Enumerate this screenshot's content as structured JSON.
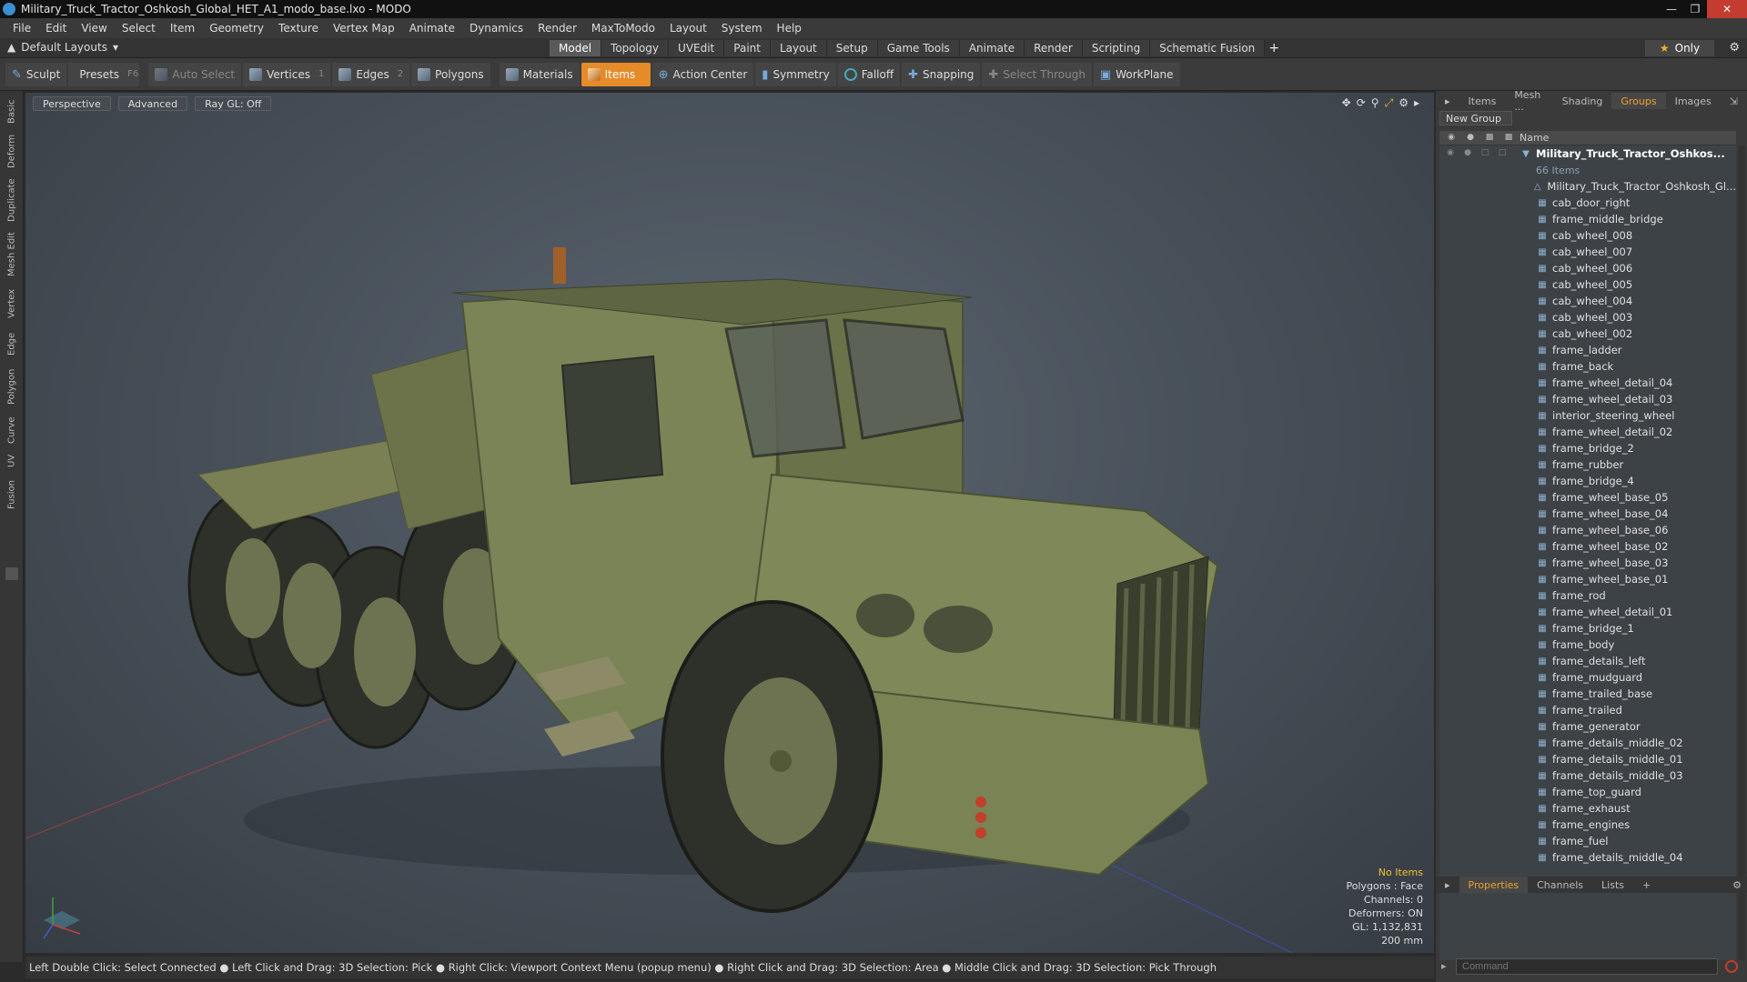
{
  "window": {
    "title": "Military_Truck_Tractor_Oshkosh_Global_HET_A1_modo_base.lxo - MODO"
  },
  "menu": [
    "File",
    "Edit",
    "View",
    "Select",
    "Item",
    "Geometry",
    "Texture",
    "Vertex Map",
    "Animate",
    "Dynamics",
    "Render",
    "MaxToModo",
    "Layout",
    "System",
    "Help"
  ],
  "layout_selector": "Default Layouts",
  "mode_tabs": [
    {
      "label": "Model",
      "active": true
    },
    {
      "label": "Topology"
    },
    {
      "label": "UVEdit"
    },
    {
      "label": "Paint"
    },
    {
      "label": "Layout"
    },
    {
      "label": "Setup"
    },
    {
      "label": "Game Tools"
    },
    {
      "label": "Animate"
    },
    {
      "label": "Render"
    },
    {
      "label": "Scripting"
    },
    {
      "label": "Schematic Fusion"
    }
  ],
  "only_button": "Only",
  "toolbar": {
    "sculpt": "Sculpt",
    "presets": "Presets",
    "presets_key": "F6",
    "auto_select": "Auto Select",
    "vertices": "Vertices",
    "vertices_key": "1",
    "edges": "Edges",
    "edges_key": "2",
    "polygons": "Polygons",
    "materials": "Materials",
    "items": "Items",
    "action_center": "Action Center",
    "symmetry": "Symmetry",
    "falloff": "Falloff",
    "snapping": "Snapping",
    "select_through": "Select Through",
    "workplane": "WorkPlane"
  },
  "left_tabs": [
    "Basic",
    "Deform",
    "Duplicate",
    "Mesh Edit",
    "Vertex",
    "Edge",
    "Polygon",
    "Curve",
    "UV",
    "Fusion"
  ],
  "viewport": {
    "perspective": "Perspective",
    "advanced": "Advanced",
    "raygl": "Ray GL: Off",
    "info": {
      "no_items": "No Items",
      "polygons": "Polygons : Face",
      "channels": "Channels: 0",
      "deformers": "Deformers: ON",
      "gl": "GL: 1,132,831",
      "scale": "200 mm"
    }
  },
  "status_bar": "Left Double Click: Select Connected ● Left Click and Drag: 3D Selection: Pick ● Right Click: Viewport Context Menu (popup menu) ● Right Click and Drag: 3D Selection: Area ● Middle Click and Drag: 3D Selection: Pick Through",
  "right_panel": {
    "tabs": [
      {
        "label": "Items"
      },
      {
        "label": "Mesh ..."
      },
      {
        "label": "Shading"
      },
      {
        "label": "Groups",
        "active": true
      },
      {
        "label": "Images"
      }
    ],
    "new_group": "New Group",
    "name_header": "Name",
    "group_name": "Military_Truck_Tractor_Oshkos...",
    "group_count": "66 Items",
    "items": [
      "Military_Truck_Tractor_Oshkosh_Gl...",
      "cab_door_right",
      "frame_middle_bridge",
      "cab_wheel_008",
      "cab_wheel_007",
      "cab_wheel_006",
      "cab_wheel_005",
      "cab_wheel_004",
      "cab_wheel_003",
      "cab_wheel_002",
      "frame_ladder",
      "frame_back",
      "frame_wheel_detail_04",
      "frame_wheel_detail_03",
      "interior_steering_wheel",
      "frame_wheel_detail_02",
      "frame_bridge_2",
      "frame_rubber",
      "frame_bridge_4",
      "frame_wheel_base_05",
      "frame_wheel_base_04",
      "frame_wheel_base_06",
      "frame_wheel_base_02",
      "frame_wheel_base_03",
      "frame_wheel_base_01",
      "frame_rod",
      "frame_wheel_detail_01",
      "frame_bridge_1",
      "frame_body",
      "frame_details_left",
      "frame_mudguard",
      "frame_trailed_base",
      "frame_trailed",
      "frame_generator",
      "frame_details_middle_02",
      "frame_details_middle_01",
      "frame_details_middle_03",
      "frame_top_guard",
      "frame_exhaust",
      "frame_engines",
      "frame_fuel",
      "frame_details_middle_04"
    ],
    "prop_tabs": [
      {
        "label": "Properties",
        "active": true
      },
      {
        "label": "Channels"
      },
      {
        "label": "Lists"
      }
    ],
    "command_placeholder": "Command"
  },
  "colors": {
    "accent": "#e58b2a",
    "truck": "#7b8456",
    "viewport_bg": "#4a535c"
  }
}
